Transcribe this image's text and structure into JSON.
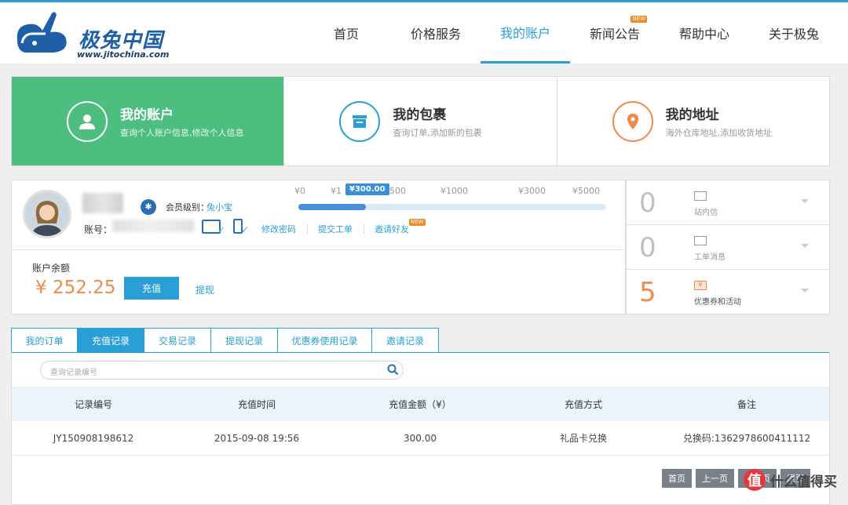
{
  "header": {
    "logo_text": "极兔中国",
    "logo_url": "www.jitochina.com",
    "nav": [
      {
        "label": "首页"
      },
      {
        "label": "价格服务"
      },
      {
        "label": "我的账户"
      },
      {
        "label": "新闻公告",
        "badge": "NEW"
      },
      {
        "label": "帮助中心"
      },
      {
        "label": "关于极兔"
      }
    ]
  },
  "cards": [
    {
      "title": "我的账户",
      "sub": "查询个人账户信息,修改个人信息",
      "icon": "user-icon"
    },
    {
      "title": "我的包裹",
      "sub": "查询订单,添加新的包裹",
      "icon": "package-icon"
    },
    {
      "title": "我的地址",
      "sub": "海外仓库地址,添加收货地址",
      "icon": "location-pin-icon"
    }
  ],
  "account": {
    "member_label": "会员级别：",
    "member_level": "兔小宝",
    "acct_label": "账号：",
    "links": {
      "change_password": "修改密码",
      "submit_ticket": "提交工单",
      "invite": "邀请好友",
      "invite_badge": "NEW"
    },
    "progress": {
      "ticks": [
        "¥0",
        "¥1",
        "¥500",
        "¥1000",
        "¥3000",
        "¥5000"
      ],
      "tip": "¥300.00",
      "fill_fraction": 0.22
    },
    "balance_label": "账户余额",
    "balance_value": "¥ 252.25",
    "recharge": "充值",
    "withdraw": "提现"
  },
  "messages": [
    {
      "count": "0",
      "label": "站内信",
      "icon": "envelope-icon"
    },
    {
      "count": "0",
      "label": "工单消息",
      "icon": "ticket-icon"
    },
    {
      "count": "5",
      "label": "优惠券和活动",
      "icon": "coupon-icon",
      "coupon_char": "¥"
    }
  ],
  "tabs": [
    "我的订单",
    "充值记录",
    "交易记录",
    "提现记录",
    "优惠券使用记录",
    "邀请记录"
  ],
  "search": {
    "placeholder": "查询记录编号"
  },
  "table": {
    "headers": [
      "记录编号",
      "充值时间",
      "充值金额（¥）",
      "充值方式",
      "备注"
    ],
    "rows": [
      [
        "JY150908198612",
        "2015-09-08 19:56",
        "300.00",
        "礼品卡兑换",
        "兑换码:1362978600411112"
      ]
    ]
  },
  "pager": [
    "首页",
    "上一页",
    "下一页",
    "尾页"
  ],
  "watermark": {
    "icon": "值",
    "text": "什么值得买"
  }
}
